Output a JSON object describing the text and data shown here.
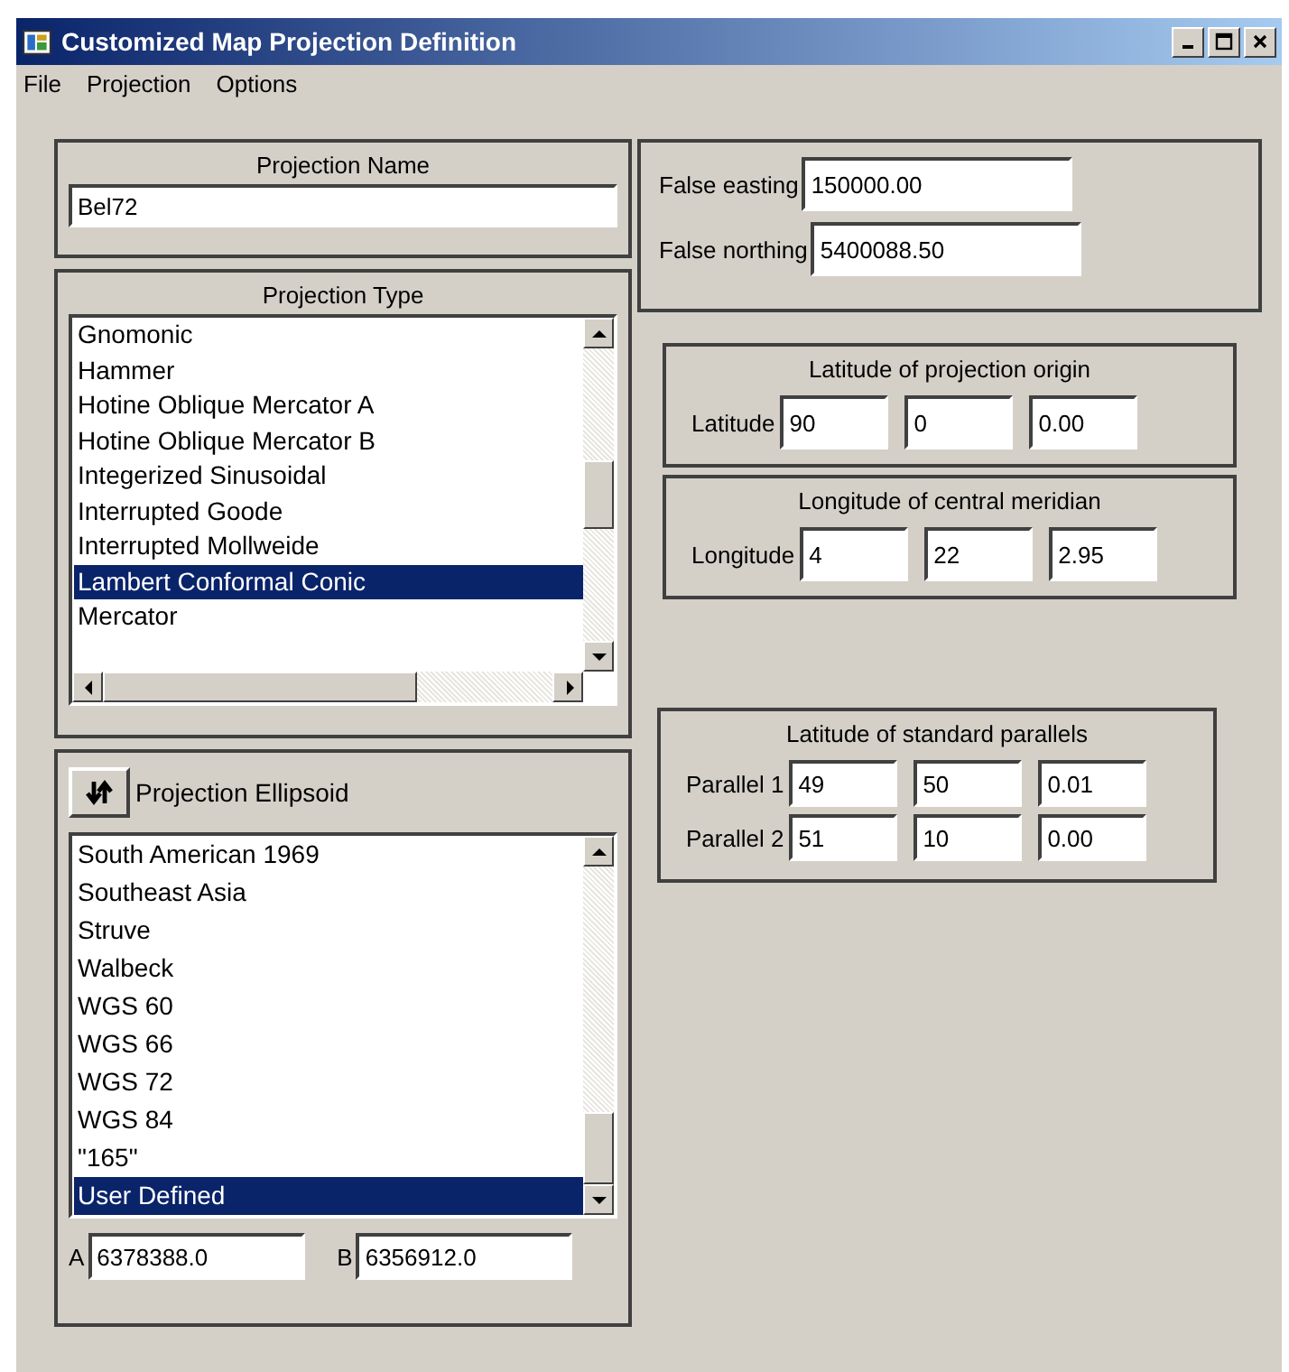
{
  "window": {
    "title": "Customized Map Projection Definition"
  },
  "menu": [
    "File",
    "Projection",
    "Options"
  ],
  "projection_name": {
    "label": "Projection Name",
    "value": "Bel72"
  },
  "projection_type": {
    "label": "Projection Type",
    "items": [
      {
        "label": "Gnomonic",
        "selected": false
      },
      {
        "label": "Hammer",
        "selected": false
      },
      {
        "label": "Hotine Oblique Mercator A",
        "selected": false
      },
      {
        "label": "Hotine Oblique Mercator B",
        "selected": false
      },
      {
        "label": "Integerized Sinusoidal",
        "selected": false
      },
      {
        "label": "Interrupted Goode",
        "selected": false
      },
      {
        "label": "Interrupted Mollweide",
        "selected": false
      },
      {
        "label": "Lambert Conformal Conic",
        "selected": true
      },
      {
        "label": "Mercator",
        "selected": false
      }
    ]
  },
  "ellipsoid": {
    "label": "Projection Ellipsoid",
    "items": [
      {
        "label": "South American 1969",
        "selected": false
      },
      {
        "label": "Southeast Asia",
        "selected": false
      },
      {
        "label": "Struve",
        "selected": false
      },
      {
        "label": "Walbeck",
        "selected": false
      },
      {
        "label": "WGS 60",
        "selected": false
      },
      {
        "label": "WGS 66",
        "selected": false
      },
      {
        "label": "WGS 72",
        "selected": false
      },
      {
        "label": "WGS 84",
        "selected": false
      },
      {
        "label": "\"165\"",
        "selected": false
      },
      {
        "label": "User Defined",
        "selected": true
      }
    ],
    "a_label": "A",
    "a_value": "6378388.0",
    "b_label": "B",
    "b_value": "6356912.0"
  },
  "false_origin": [
    {
      "label": "False easting",
      "value": "150000.00"
    },
    {
      "label": "False northing",
      "value": "5400088.50"
    }
  ],
  "groups": [
    {
      "title": "Latitude of projection origin",
      "rows": [
        {
          "label": "Latitude",
          "values": [
            "90",
            "0",
            "0.00"
          ]
        }
      ]
    },
    {
      "title": "Longitude of central meridian",
      "rows": [
        {
          "label": "Longitude",
          "values": [
            "4",
            "22",
            "2.95"
          ]
        }
      ]
    },
    {
      "title": "Latitude of standard parallels",
      "rows": [
        {
          "label": "Parallel 1",
          "values": [
            "49",
            "50",
            "0.01"
          ]
        },
        {
          "label": "Parallel 2",
          "values": [
            "51",
            "10",
            "0.00"
          ]
        }
      ]
    }
  ]
}
